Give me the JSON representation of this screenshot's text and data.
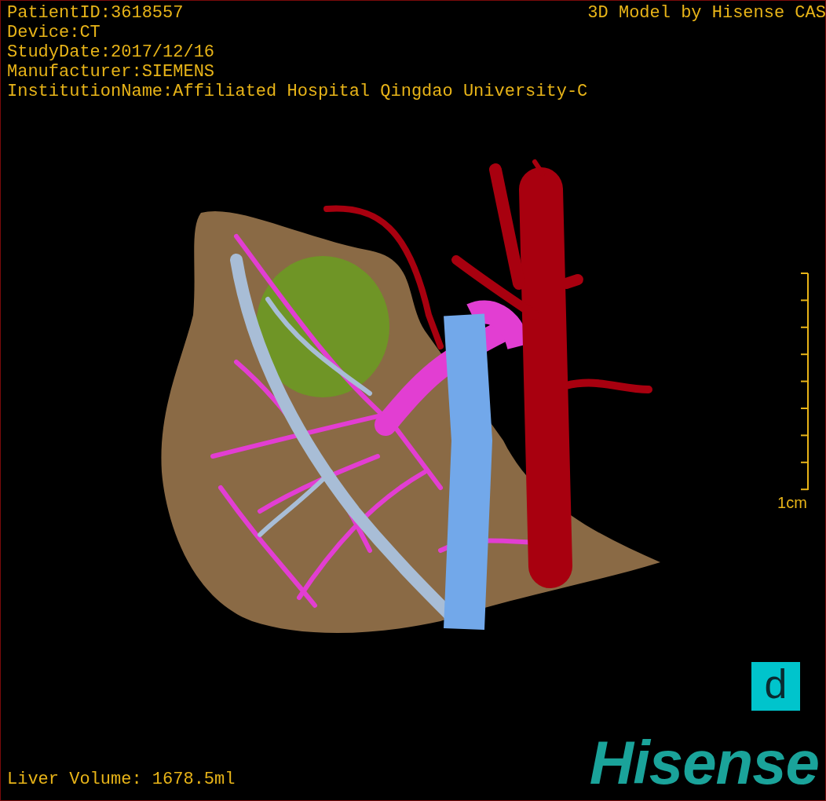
{
  "overlay_top_left": [
    "PatientID:3618557",
    "Device:CT",
    "StudyDate:2017/12/16",
    "Manufacturer:SIEMENS",
    "InstitutionName:Affiliated Hospital Qingdao University-C"
  ],
  "overlay_top_right": "3D Model by Hisense CAS",
  "scale_bar": {
    "label": "1cm"
  },
  "liver_volume": "Liver Volume: 1678.5ml",
  "badge": "d",
  "logo": "Hisense"
}
